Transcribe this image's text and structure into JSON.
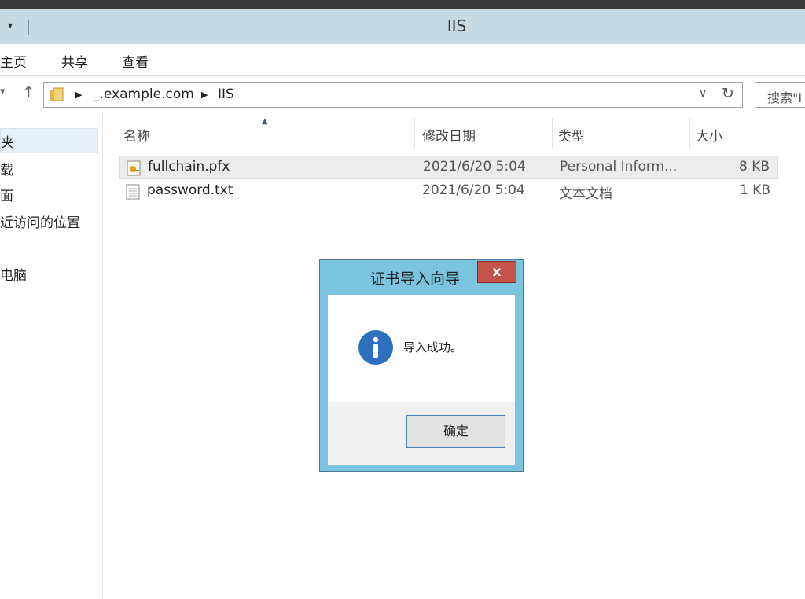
{
  "window": {
    "title": "IIS",
    "quick_access": "▾"
  },
  "menu": {
    "items": [
      "主页",
      "共享",
      "查看"
    ]
  },
  "address": {
    "crumbs": [
      "_.example.com",
      "IIS"
    ],
    "search_placeholder": "搜索\"I"
  },
  "sidebar": {
    "items": [
      "夹",
      "载",
      "面",
      "近访问的位置",
      "电脑"
    ]
  },
  "columns": [
    "名称",
    "修改日期",
    "类型",
    "大小"
  ],
  "files": [
    {
      "name": "fullchain.pfx",
      "date": "2021/6/20 5:04",
      "type": "Personal Inform...",
      "size": "8 KB",
      "icon": "certificate-file-icon"
    },
    {
      "name": "password.txt",
      "date": "2021/6/20 5:04",
      "type": "文本文档",
      "size": "1 KB",
      "icon": "text-file-icon"
    }
  ],
  "dialog": {
    "title": "证书导入向导",
    "message": "导入成功。",
    "ok_label": "确定",
    "close_label": "x",
    "icon": "info-icon"
  }
}
